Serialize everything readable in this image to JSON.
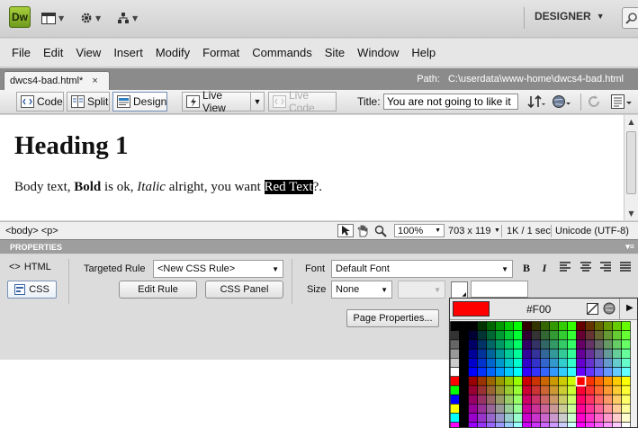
{
  "app": {
    "logo": "Dw",
    "workspace": "DESIGNER",
    "menus": [
      "File",
      "Edit",
      "View",
      "Insert",
      "Modify",
      "Format",
      "Commands",
      "Site",
      "Window",
      "Help"
    ]
  },
  "document": {
    "tab_name": "dwcs4-bad.html*",
    "close_glyph": "×",
    "path_label": "Path:",
    "path": "C:\\userdata\\www-home\\dwcs4-bad.html"
  },
  "toolbar": {
    "code": "Code",
    "split": "Split",
    "design": "Design",
    "live_view": "Live View",
    "live_code": "Live Code",
    "title_label": "Title:",
    "title_value": "You are not going to like it"
  },
  "content": {
    "heading": "Heading 1",
    "body_prefix": "Body text, ",
    "bold": "Bold",
    "mid1": " is ok, ",
    "italic": "Italic",
    "mid2": " alright, you want ",
    "selected": "Red Text",
    "suffix": "?."
  },
  "status": {
    "tags": "<body> <p>",
    "zoom": "100%",
    "size": "703 x 119",
    "download": "1K / 1 sec",
    "encoding": "Unicode (UTF-8)"
  },
  "properties": {
    "header": "PROPERTIES",
    "html": "HTML",
    "css": "CSS",
    "targeted_rule_label": "Targeted Rule",
    "targeted_rule_value": "<New CSS Rule>",
    "edit_rule": "Edit Rule",
    "css_panel": "CSS Panel",
    "font_label": "Font",
    "font_value": "Default Font",
    "size_label": "Size",
    "size_value": "None",
    "bold_glyph": "B",
    "italic_glyph": "I",
    "page_properties": "Page Properties..."
  },
  "picker": {
    "hex": "#F00",
    "selected_color": "#ff0000"
  }
}
